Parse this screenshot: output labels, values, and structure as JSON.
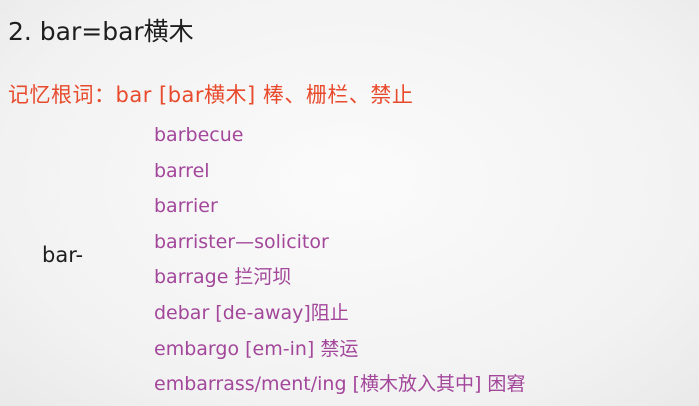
{
  "heading": "2. bar=bar横木",
  "mnemonic": "记忆根词：bar [bar横木] 棒、栅栏、禁止",
  "root_label": "bar-",
  "words": [
    "barbecue",
    "barrel",
    "barrier",
    "barrister—solicitor",
    "barrage 拦河坝",
    "debar [de-away]阻止",
    "embargo  [em-in] 禁运",
    "embarrass/ment/ing [横木放入其中] 困窘"
  ]
}
